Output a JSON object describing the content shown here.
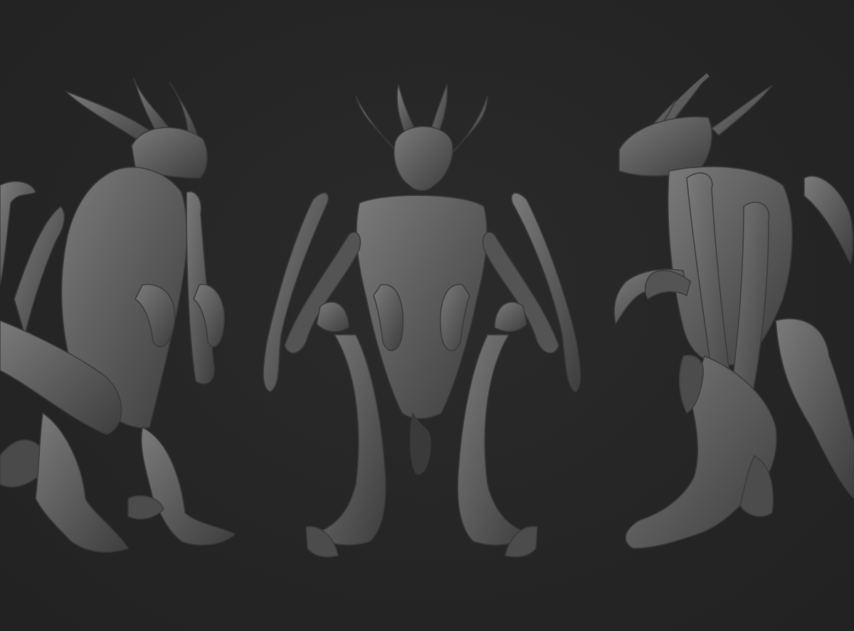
{
  "scene": {
    "background_color": "#262626",
    "model_color": "#5c5c5c",
    "views": [
      {
        "name": "three-quarter-front-view"
      },
      {
        "name": "front-view"
      },
      {
        "name": "side-view"
      }
    ]
  }
}
